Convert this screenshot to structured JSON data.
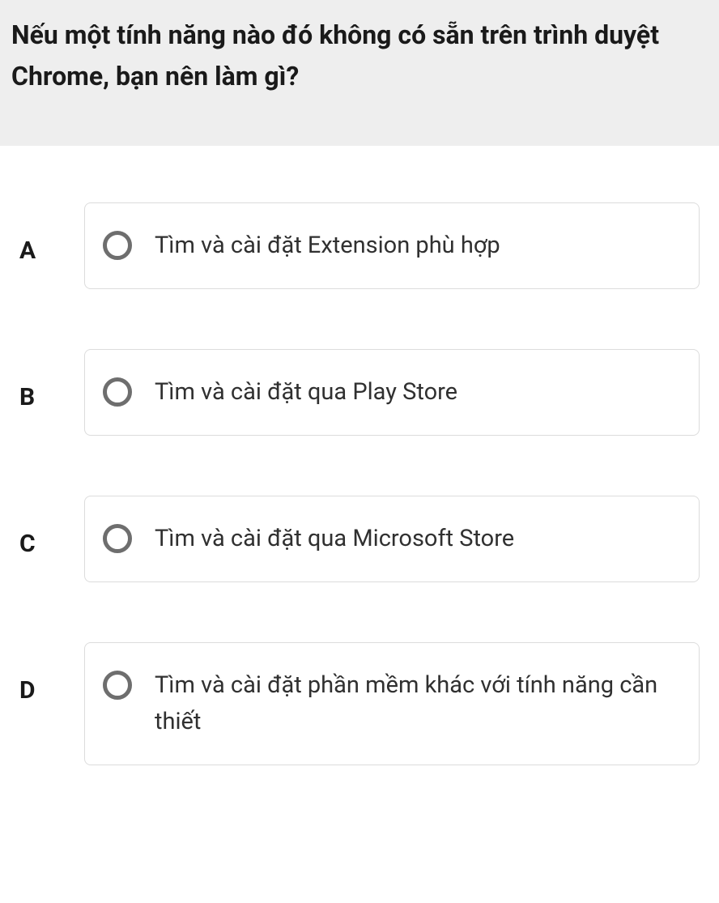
{
  "question": "Nếu một tính năng nào đó không có sẵn trên trình duyệt Chrome, bạn nên làm gì?",
  "options": [
    {
      "letter": "A",
      "text": "Tìm và cài đặt Extension phù hợp"
    },
    {
      "letter": "B",
      "text": "Tìm và cài đặt qua Play Store"
    },
    {
      "letter": "C",
      "text": "Tìm và cài đặt qua Microsoft Store"
    },
    {
      "letter": "D",
      "text": "Tìm và cài đặt phần mềm khác với tính năng cần thiết"
    }
  ]
}
